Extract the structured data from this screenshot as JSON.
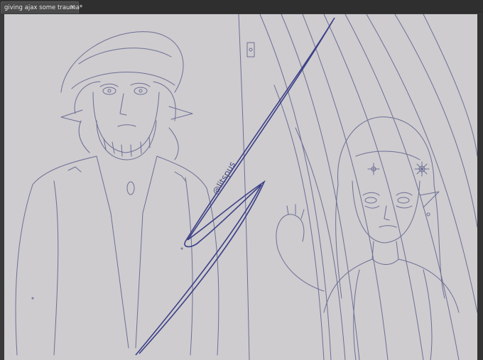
{
  "document": {
    "tab_title": "giving ajax some trauma*",
    "tab_close_glyph": "✕"
  },
  "canvas": {
    "signature": "@litspus",
    "background_color": "#cecccf",
    "sketch_color": "#6d6f95",
    "accent_color": "#3b3f86"
  }
}
